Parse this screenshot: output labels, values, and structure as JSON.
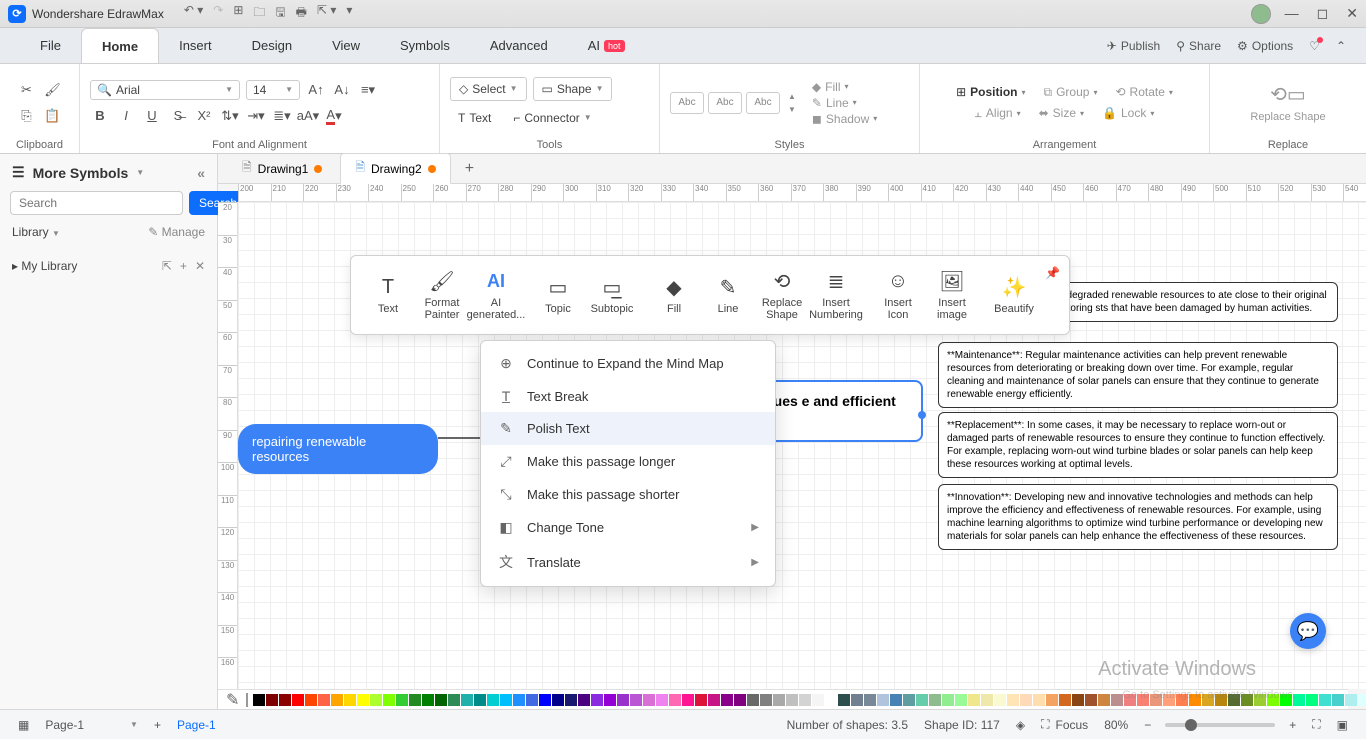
{
  "app": {
    "title": "Wondershare EdrawMax"
  },
  "menu": {
    "tabs": [
      "File",
      "Home",
      "Insert",
      "Design",
      "View",
      "Symbols",
      "Advanced",
      "AI"
    ],
    "active": "Home",
    "hot": "hot",
    "right": {
      "publish": "Publish",
      "share": "Share",
      "options": "Options"
    }
  },
  "ribbon": {
    "clipboard": "Clipboard",
    "font": {
      "name": "Arial",
      "size": "14",
      "group_label": "Font and Alignment"
    },
    "tools": {
      "select": "Select",
      "shape": "Shape",
      "text": "Text",
      "connector": "Connector",
      "group_label": "Tools"
    },
    "styles": {
      "abc": "Abc",
      "group_label": "Styles",
      "fill": "Fill",
      "line": "Line",
      "shadow": "Shadow"
    },
    "arrangement": {
      "position": "Position",
      "align": "Align",
      "group": "Group",
      "size": "Size",
      "rotate": "Rotate",
      "lock": "Lock",
      "group_label": "Arrangement"
    },
    "replace": {
      "label": "Replace Shape",
      "group_label": "Replace"
    }
  },
  "leftpanel": {
    "header": "More Symbols",
    "search_placeholder": "Search",
    "search_btn": "Search",
    "library": "Library",
    "manage": "Manage",
    "mylibrary": "My Library"
  },
  "doctabs": {
    "tab1": "Drawing1",
    "tab2": "Drawing2"
  },
  "ruler_start": 200,
  "ruler_v_start": 20,
  "floatbar": {
    "items": [
      "Text",
      "Format Painter",
      "AI generated...",
      "",
      "Topic",
      "Subtopic",
      "",
      "Fill",
      "Line",
      "Replace Shape",
      "Insert Numbering",
      "",
      "Insert Icon",
      "Insert image",
      "",
      "Beautify"
    ]
  },
  "ctxmenu": {
    "items": [
      {
        "icon": "⊕",
        "label": "Continue to Expand the Mind Map",
        "arrow": false
      },
      {
        "icon": "T̲",
        "label": "Text Break",
        "arrow": false
      },
      {
        "icon": "✎",
        "label": "Polish Text",
        "arrow": false,
        "hover": true
      },
      {
        "icon": "⤢",
        "label": "Make this passage longer",
        "arrow": false
      },
      {
        "icon": "⤡",
        "label": "Make this passage shorter",
        "arrow": false
      },
      {
        "icon": "◧",
        "label": "Change Tone",
        "arrow": true
      },
      {
        "icon": "文",
        "label": "Translate",
        "arrow": true
      }
    ]
  },
  "nodes": {
    "root": "repairing renewable resources",
    "main": "ood condition can s and techniques e and efficient roaches to fixing t include:",
    "sub1": "olves reviving damaged or degraded renewable resources to ate close to their original condition. For example, restoring sts that have been damaged by human activities.",
    "sub2": "**Maintenance**: Regular maintenance activities can help prevent renewable resources from deteriorating or breaking down over time. For example, regular cleaning and maintenance of solar panels can ensure that they continue to generate renewable energy efficiently.",
    "sub3": "**Replacement**: In some cases, it may be necessary to replace worn-out or damaged parts of renewable resources to ensure they continue to function effectively. For example, replacing worn-out wind turbine blades or solar panels can help keep these resources working at optimal levels.",
    "sub4": "**Innovation**: Developing new and innovative technologies and methods can help improve the efficiency and effectiveness of renewable resources. For example, using machine learning algorithms to optimize wind turbine performance or developing new materials for solar panels can help enhance the effectiveness of these resources."
  },
  "status": {
    "page": "Page-1",
    "page_active": "Page-1",
    "shapes": "Number of shapes: 3.5",
    "shapeid": "Shape ID: 117",
    "focus": "Focus",
    "zoom": "80%"
  },
  "watermark": {
    "line1": "Activate Windows",
    "line2": "Go to Settings to activate Windows."
  },
  "colors": [
    "#000000",
    "#7f0000",
    "#8b0000",
    "#ff0000",
    "#ff4500",
    "#ff6347",
    "#ffa500",
    "#ffd700",
    "#ffff00",
    "#adff2f",
    "#7fff00",
    "#32cd32",
    "#228b22",
    "#008000",
    "#006400",
    "#2e8b57",
    "#20b2aa",
    "#008b8b",
    "#00ced1",
    "#00bfff",
    "#1e90ff",
    "#4169e1",
    "#0000ff",
    "#00008b",
    "#191970",
    "#4b0082",
    "#8a2be2",
    "#9400d3",
    "#9932cc",
    "#ba55d3",
    "#da70d6",
    "#ee82ee",
    "#ff69b4",
    "#ff1493",
    "#dc143c",
    "#c71585",
    "#8b008b",
    "#800080",
    "#696969",
    "#808080",
    "#a9a9a9",
    "#c0c0c0",
    "#d3d3d3",
    "#f5f5f5",
    "#ffffff",
    "#2f4f4f",
    "#708090",
    "#778899",
    "#b0c4de",
    "#4682b4",
    "#5f9ea0",
    "#66cdaa",
    "#8fbc8f",
    "#90ee90",
    "#98fb98",
    "#f0e68c",
    "#eee8aa",
    "#fafad2",
    "#ffe4b5",
    "#ffdab9",
    "#ffdead",
    "#f4a460",
    "#d2691e",
    "#8b4513",
    "#a0522d",
    "#cd853f",
    "#bc8f8f",
    "#f08080",
    "#fa8072",
    "#e9967a",
    "#ffa07a",
    "#ff7f50",
    "#ff8c00",
    "#daa520",
    "#b8860b",
    "#556b2f",
    "#6b8e23",
    "#9acd32",
    "#7cfc00",
    "#00ff00",
    "#00fa9a",
    "#00ff7f",
    "#40e0d0",
    "#48d1cc",
    "#afeeee",
    "#e0ffff",
    "#f0ffff"
  ]
}
